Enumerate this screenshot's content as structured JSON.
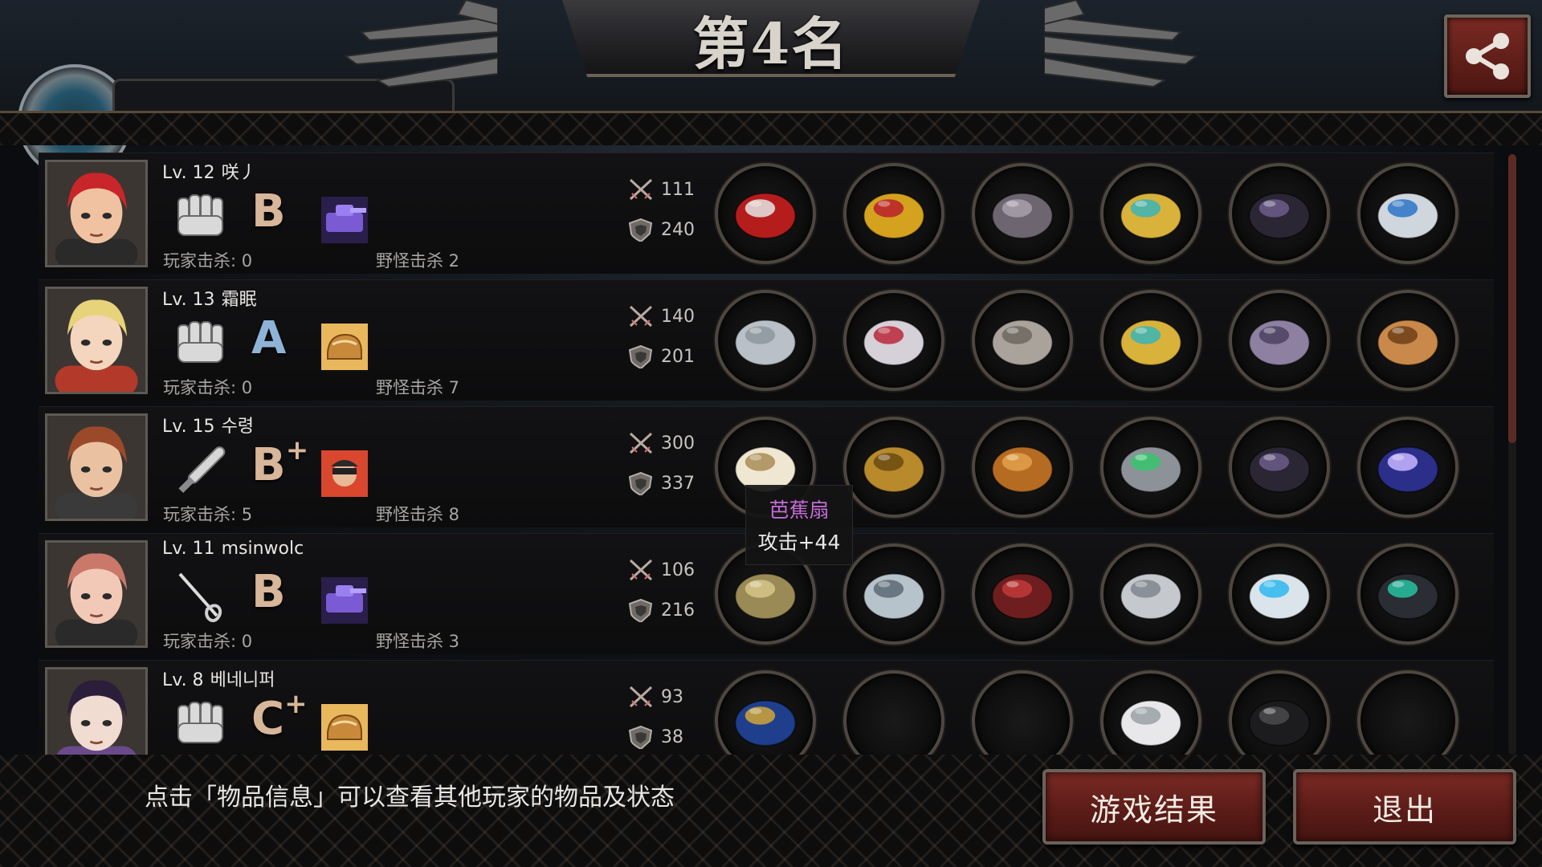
{
  "title": "第4名",
  "players": [
    {
      "level": "Lv. 12",
      "name": "咲丿",
      "grade": "B",
      "grade_plus": "",
      "player_kills_label": "玩家击杀: 0",
      "monster_kills_label": "野怪击杀 2",
      "attack": "111",
      "defense": "240",
      "weapon_icon": "fist-icon",
      "badge_icon": "purple-tank-badge-icon",
      "items": [
        "red-goggles-icon",
        "golden-crown-icon",
        "iron-armor-icon",
        "gold-bracelet-icon",
        "dark-boots-icon",
        "blue-gem-ring-icon"
      ]
    },
    {
      "level": "Lv. 13",
      "name": "霜眠",
      "grade": "A",
      "grade_plus": "",
      "player_kills_label": "玩家击杀: 0",
      "monster_kills_label": "野怪击杀 7",
      "attack": "140",
      "defense": "201",
      "weapon_icon": "fist-icon",
      "badge_icon": "bread-badge-icon",
      "items": [
        "steel-gauntlet-icon",
        "silver-tiara-icon",
        "plate-armor-icon",
        "gold-bracelet-icon",
        "purple-boots-icon",
        "cat-box-icon"
      ]
    },
    {
      "level": "Lv. 15",
      "name": "수령",
      "grade": "B",
      "grade_plus": "+",
      "player_kills_label": "玩家击杀: 5",
      "monster_kills_label": "野怪击杀 8",
      "attack": "300",
      "defense": "337",
      "weapon_icon": "bat-icon",
      "badge_icon": "face-portrait-badge-icon",
      "items": [
        "paper-fan-icon",
        "golden-helmet-icon",
        "bronze-armor-icon",
        "radar-device-icon",
        "dark-boots-icon",
        "galaxy-icon"
      ]
    },
    {
      "level": "Lv. 11",
      "name": "msinwolc",
      "grade": "B",
      "grade_plus": "",
      "player_kills_label": "玩家击杀: 0",
      "monster_kills_label": "野怪击杀 3",
      "attack": "106",
      "defense": "216",
      "weapon_icon": "rapier-icon",
      "badge_icon": "purple-tank-badge-icon",
      "items": [
        "trident-icon",
        "knight-helmet-icon",
        "red-coat-icon",
        "spiked-bracer-icon",
        "glowing-sneakers-icon",
        "scope-icon"
      ]
    },
    {
      "level": "Lv. 8",
      "name": "베네니퍼",
      "grade": "C",
      "grade_plus": "+",
      "player_kills_label": "",
      "monster_kills_label": "",
      "attack": "93",
      "defense": "38",
      "weapon_icon": "fist-icon",
      "badge_icon": "bread-badge-icon",
      "items": [
        "blue-gauntlet-icon",
        "empty-slot",
        "empty-slot",
        "white-bracer-icon",
        "black-boots-icon",
        "empty-slot"
      ]
    }
  ],
  "tooltip": {
    "item_name": "芭蕉扇",
    "stat": "攻击+44"
  },
  "hint": "点击「物品信息」可以查看其他玩家的物品及状态",
  "buttons": {
    "result": "游戏结果",
    "exit": "退出"
  },
  "colors": {
    "accent_red": "#6b2520",
    "tooltip_name": "#c56bd8",
    "grade_b": "#d8b69a",
    "grade_a": "#8fb3d6"
  }
}
